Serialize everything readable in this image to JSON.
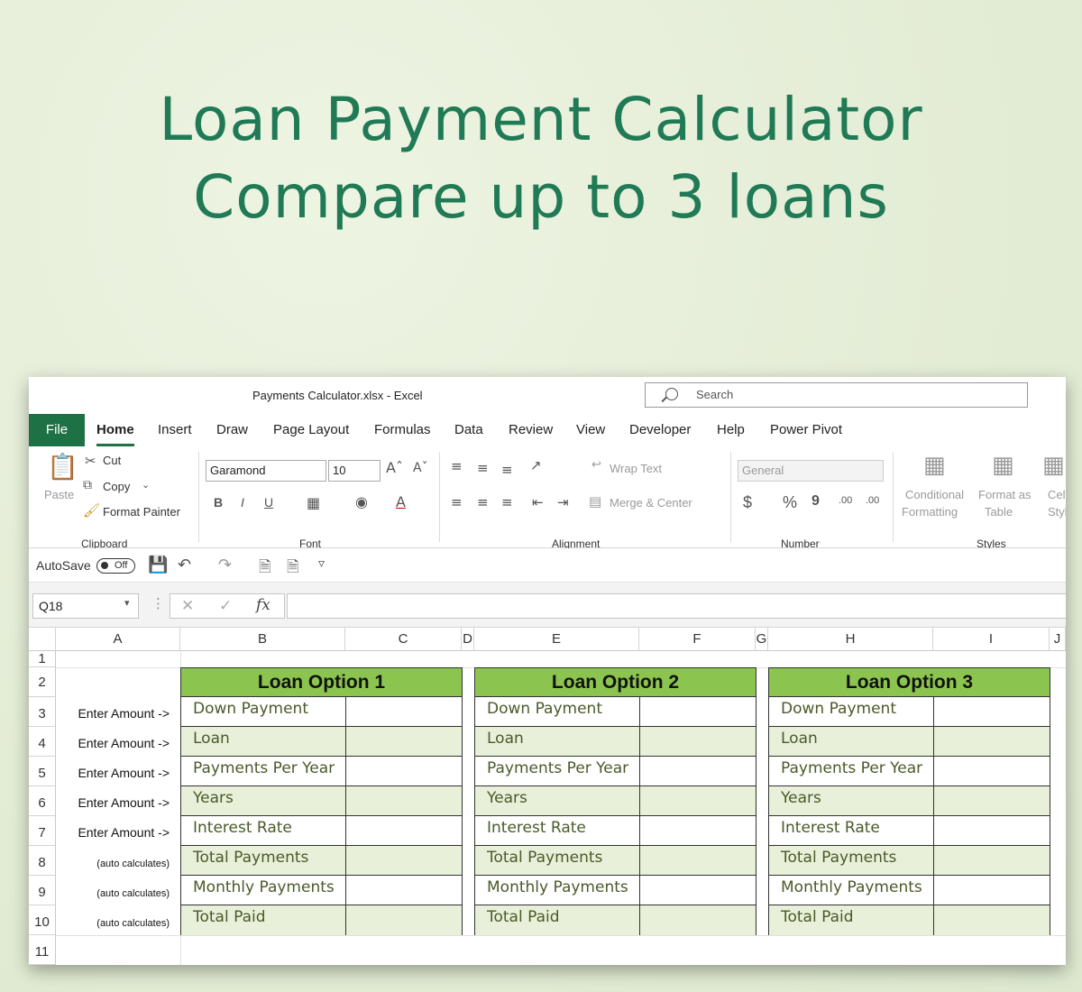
{
  "heading": {
    "line1": "Loan Payment Calculator",
    "line2": "Compare up to 3 loans"
  },
  "window": {
    "filename": "Payments Calculator.xlsx  -  Excel",
    "search_placeholder": "Search"
  },
  "tabs": [
    "File",
    "Home",
    "Insert",
    "Draw",
    "Page Layout",
    "Formulas",
    "Data",
    "Review",
    "View",
    "Developer",
    "Help",
    "Power Pivot"
  ],
  "ribbon": {
    "clipboard": {
      "paste": "Paste",
      "cut": "Cut",
      "copy": "Copy",
      "format_painter": "Format Painter",
      "group": "Clipboard"
    },
    "font": {
      "name": "Garamond",
      "size": "10",
      "bold": "B",
      "italic": "I",
      "underline": "U",
      "group": "Font"
    },
    "alignment": {
      "wrap_text": "Wrap Text",
      "merge_center": "Merge & Center",
      "group": "Alignment"
    },
    "number": {
      "format": "General",
      "currency": "$",
      "percent": "%",
      "comma": "9",
      "inc_dec": ".00",
      "group": "Number"
    },
    "styles": {
      "conditional_1": "Conditional",
      "conditional_2": "Formatting",
      "format_table_1": "Format as",
      "format_table_2": "Table",
      "cell_1": "Cel",
      "cell_2": "Styles",
      "group": "Styles"
    }
  },
  "qat": {
    "autosave": "AutoSave",
    "toggle": "Off"
  },
  "formula_bar": {
    "name_box": "Q18",
    "fx": "fx",
    "content": ""
  },
  "columns": [
    "A",
    "B",
    "C",
    "D",
    "E",
    "F",
    "G",
    "H",
    "I",
    "J"
  ],
  "rows": [
    "1",
    "2",
    "3",
    "4",
    "5",
    "6",
    "7",
    "8",
    "9",
    "10",
    "11"
  ],
  "row_keys": [
    "Enter Amount ->",
    "Enter Amount ->",
    "Enter Amount ->",
    "Enter Amount ->",
    "Enter Amount ->",
    "(auto calculates)",
    "(auto calculates)",
    "(auto calculates)"
  ],
  "loans": [
    {
      "title": "Loan Option 1",
      "fields": [
        "Down Payment",
        "Loan",
        "Payments Per Year",
        "Years",
        "Interest Rate",
        "Total Payments",
        "Monthly Payments",
        "Total Paid"
      ]
    },
    {
      "title": "Loan Option 2",
      "fields": [
        "Down Payment",
        "Loan",
        "Payments Per Year",
        "Years",
        "Interest Rate",
        "Total Payments",
        "Monthly Payments",
        "Total Paid"
      ]
    },
    {
      "title": "Loan Option 3",
      "fields": [
        "Down Payment",
        "Loan",
        "Payments Per Year",
        "Years",
        "Interest Rate",
        "Total Payments",
        "Monthly Payments",
        "Total Paid"
      ]
    }
  ],
  "colors": {
    "accent": "#1e7145",
    "header_fill": "#8cc450",
    "row_shade": "#e9f0da",
    "heading_text": "#1f7a55"
  }
}
